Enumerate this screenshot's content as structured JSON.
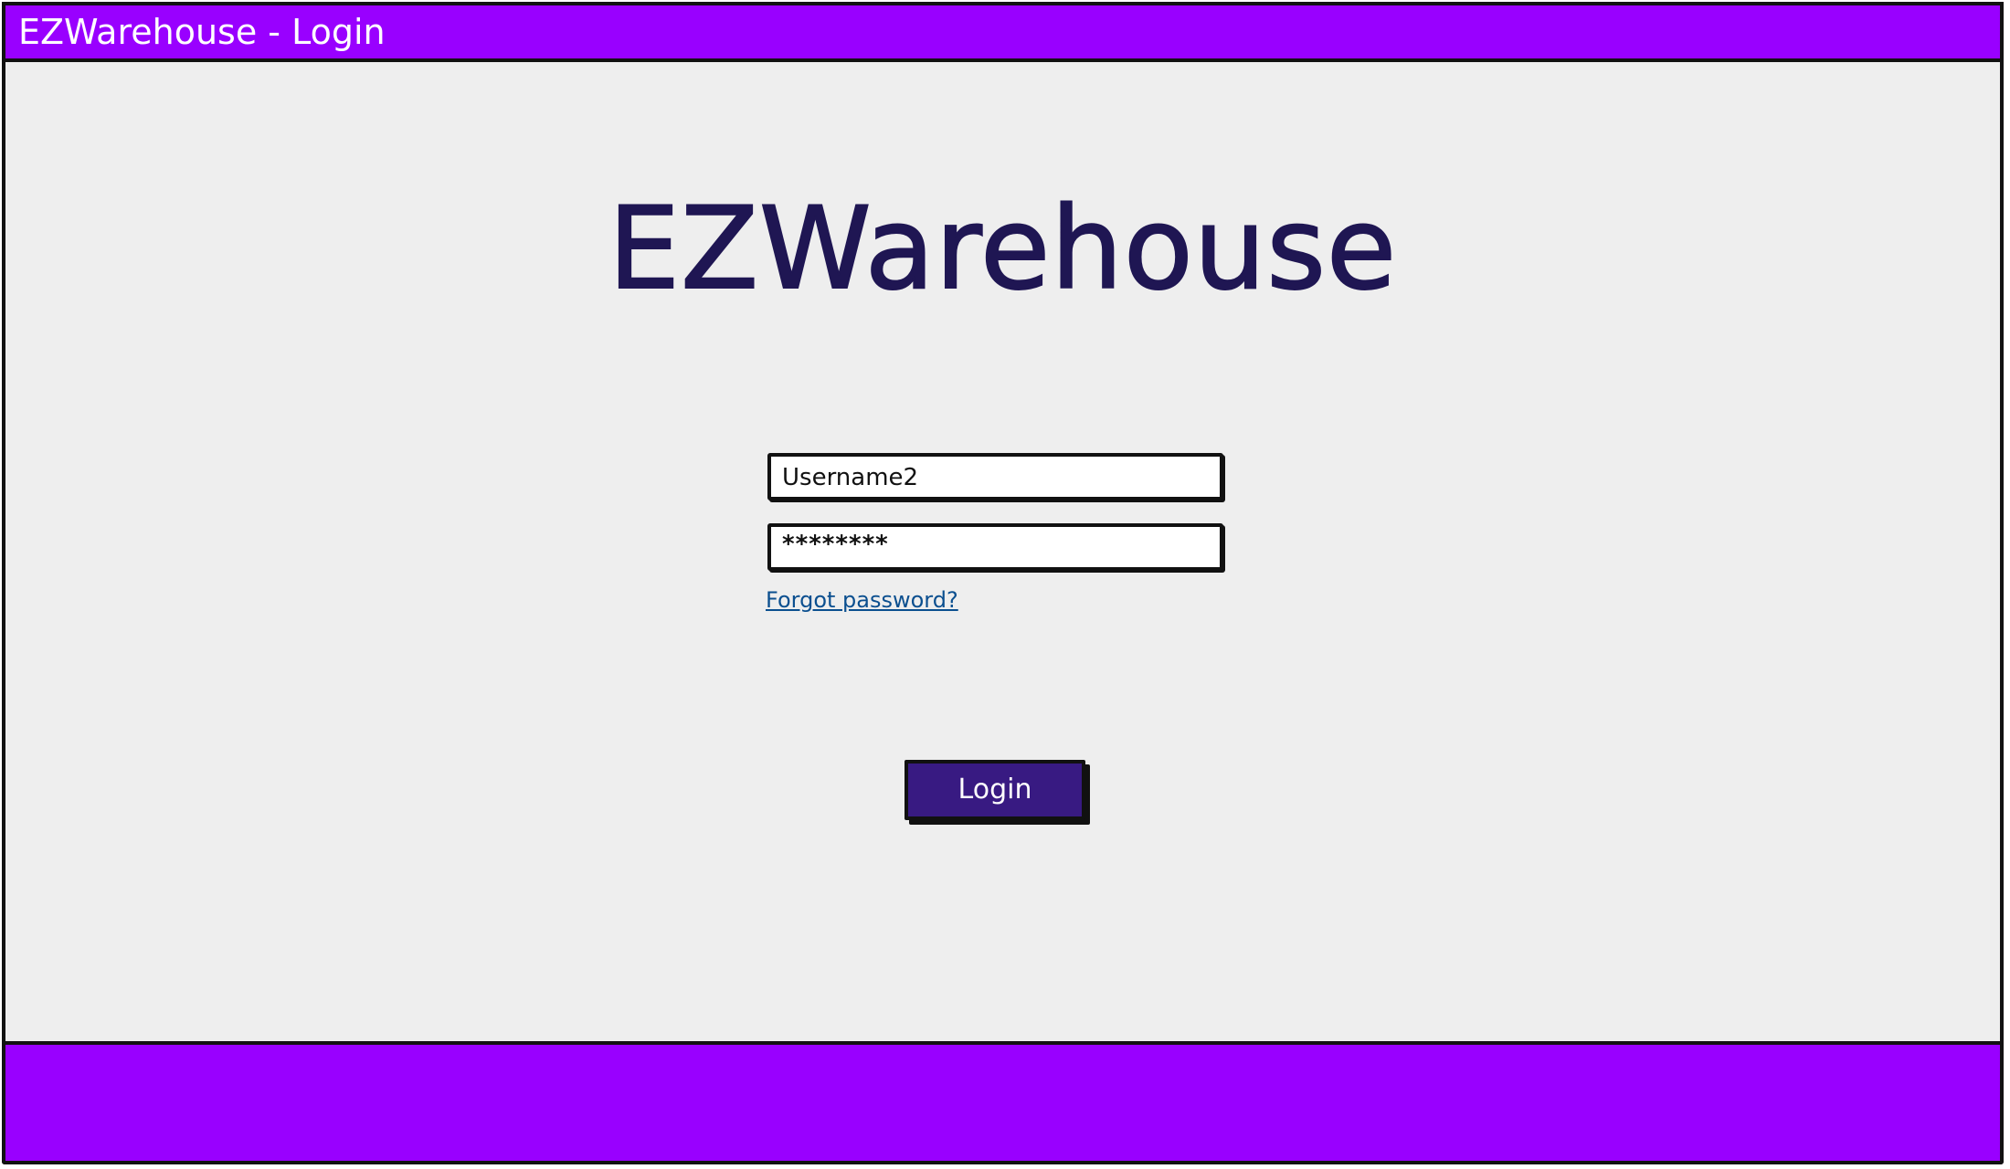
{
  "window": {
    "title": "EZWarehouse - Login"
  },
  "main": {
    "logo_text": "EZWarehouse",
    "username_value": "Username2",
    "password_value": "********",
    "forgot_password_link": "Forgot password?",
    "login_button_label": "Login"
  },
  "colors": {
    "titlebar": "#9900ff",
    "footer": "#9900ff",
    "background": "#eeeeee",
    "logo": "#1f1653",
    "login_button": "#381a82",
    "link": "#0b4f8f"
  }
}
